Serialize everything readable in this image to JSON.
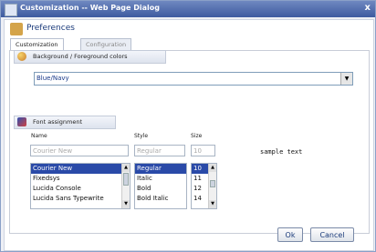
{
  "window": {
    "title": "Customization -- Web Page Dialog",
    "close_label": "x"
  },
  "header": {
    "title": "Preferences",
    "icon": "preferences-icon"
  },
  "tabs": [
    {
      "label": "Customization",
      "active": true
    },
    {
      "label": "Configuration",
      "active": false
    }
  ],
  "colors_section": {
    "title": "Background / Foreground colors",
    "icon": "palette-icon",
    "selected": "Blue/Navy"
  },
  "font_section": {
    "title": "Font assignment",
    "icon": "font-icon",
    "name_label": "Name",
    "style_label": "Style",
    "size_label": "Size",
    "name_value": "Courier New",
    "style_value": "Regular",
    "size_value": "10",
    "sample_text": "sample text",
    "names": [
      "Courier New",
      "Fixedsys",
      "Lucida Console",
      "Lucida Sans Typewrite"
    ],
    "styles": [
      "Regular",
      "Italic",
      "Bold",
      "Bold Italic"
    ],
    "sizes": [
      "10",
      "11",
      "12",
      "14"
    ]
  },
  "buttons": {
    "ok": "Ok",
    "cancel": "Cancel"
  },
  "colors": {
    "titlebar": "#3d5aa0",
    "selection": "#2a4aa8",
    "accent": "#1a3a7a"
  }
}
